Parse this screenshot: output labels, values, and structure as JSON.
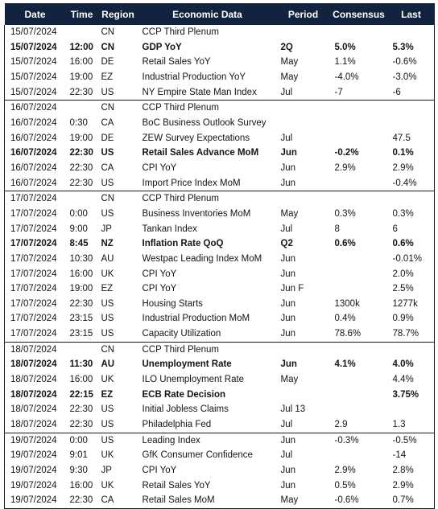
{
  "table": {
    "columns": [
      {
        "key": "date",
        "label": "Date"
      },
      {
        "key": "time",
        "label": "Time"
      },
      {
        "key": "region",
        "label": "Region"
      },
      {
        "key": "data",
        "label": "Economic Data"
      },
      {
        "key": "period",
        "label": "Period"
      },
      {
        "key": "consensus",
        "label": "Consensus"
      },
      {
        "key": "last",
        "label": "Last"
      }
    ],
    "header_background": "#12233f",
    "header_text_color": "#ffffff",
    "rows": [
      {
        "date": "15/07/2024",
        "time": "",
        "region": "CN",
        "data": "CCP Third Plenum",
        "period": "",
        "consensus": "",
        "last": "",
        "highlight": false,
        "group_start": true
      },
      {
        "date": "15/07/2024",
        "time": "12:00",
        "region": "CN",
        "data": "GDP YoY",
        "period": "2Q",
        "consensus": "5.0%",
        "last": "5.3%",
        "highlight": true,
        "group_start": false
      },
      {
        "date": "15/07/2024",
        "time": "16:00",
        "region": "DE",
        "data": "Retail Sales YoY",
        "period": "May",
        "consensus": "1.1%",
        "last": "-0.6%",
        "highlight": false,
        "group_start": false
      },
      {
        "date": "15/07/2024",
        "time": "19:00",
        "region": "EZ",
        "data": "Industrial Production YoY",
        "period": "May",
        "consensus": "-4.0%",
        "last": "-3.0%",
        "highlight": false,
        "group_start": false
      },
      {
        "date": "15/07/2024",
        "time": "22:30",
        "region": "US",
        "data": "NY Empire State Man Index",
        "period": "Jul",
        "consensus": "-7",
        "last": "-6",
        "highlight": false,
        "group_start": false
      },
      {
        "date": "16/07/2024",
        "time": "",
        "region": "CN",
        "data": "CCP Third Plenum",
        "period": "",
        "consensus": "",
        "last": "",
        "highlight": false,
        "group_start": true
      },
      {
        "date": "16/07/2024",
        "time": "0:30",
        "region": "CA",
        "data": "BoC Business Outlook Survey",
        "period": "",
        "consensus": "",
        "last": "",
        "highlight": false,
        "group_start": false
      },
      {
        "date": "16/07/2024",
        "time": "19:00",
        "region": "DE",
        "data": "ZEW Survey Expectations",
        "period": "Jul",
        "consensus": "",
        "last": "47.5",
        "highlight": false,
        "group_start": false
      },
      {
        "date": "16/07/2024",
        "time": "22:30",
        "region": "US",
        "data": "Retail Sales Advance MoM",
        "period": "Jun",
        "consensus": "-0.2%",
        "last": "0.1%",
        "highlight": true,
        "group_start": false
      },
      {
        "date": "16/07/2024",
        "time": "22:30",
        "region": "CA",
        "data": "CPI YoY",
        "period": "Jun",
        "consensus": "2.9%",
        "last": "2.9%",
        "highlight": false,
        "group_start": false
      },
      {
        "date": "16/07/2024",
        "time": "22:30",
        "region": "US",
        "data": "Import Price Index MoM",
        "period": "Jun",
        "consensus": "",
        "last": "-0.4%",
        "highlight": false,
        "group_start": false
      },
      {
        "date": "17/07/2024",
        "time": "",
        "region": "CN",
        "data": "CCP Third Plenum",
        "period": "",
        "consensus": "",
        "last": "",
        "highlight": false,
        "group_start": true
      },
      {
        "date": "17/07/2024",
        "time": "0:00",
        "region": "US",
        "data": "Business Inventories MoM",
        "period": "May",
        "consensus": "0.3%",
        "last": "0.3%",
        "highlight": false,
        "group_start": false
      },
      {
        "date": "17/07/2024",
        "time": "9:00",
        "region": "JP",
        "data": "Tankan Index",
        "period": "Jul",
        "consensus": "8",
        "last": "6",
        "highlight": false,
        "group_start": false
      },
      {
        "date": "17/07/2024",
        "time": "8:45",
        "region": "NZ",
        "data": "Inflation Rate QoQ",
        "period": "Q2",
        "consensus": "0.6%",
        "last": "0.6%",
        "highlight": true,
        "group_start": false
      },
      {
        "date": "17/07/2024",
        "time": "10:30",
        "region": "AU",
        "data": "Westpac Leading Index MoM",
        "period": "Jun",
        "consensus": "",
        "last": "-0.01%",
        "highlight": false,
        "group_start": false
      },
      {
        "date": "17/07/2024",
        "time": "16:00",
        "region": "UK",
        "data": "CPI YoY",
        "period": "Jun",
        "consensus": "",
        "last": "2.0%",
        "highlight": false,
        "group_start": false
      },
      {
        "date": "17/07/2024",
        "time": "19:00",
        "region": "EZ",
        "data": "CPI YoY",
        "period": "Jun F",
        "consensus": "",
        "last": "2.5%",
        "highlight": false,
        "group_start": false
      },
      {
        "date": "17/07/2024",
        "time": "22:30",
        "region": "US",
        "data": "Housing Starts",
        "period": "Jun",
        "consensus": "1300k",
        "last": "1277k",
        "highlight": false,
        "group_start": false
      },
      {
        "date": "17/07/2024",
        "time": "23:15",
        "region": "US",
        "data": "Industrial Production MoM",
        "period": "Jun",
        "consensus": "0.4%",
        "last": "0.9%",
        "highlight": false,
        "group_start": false
      },
      {
        "date": "17/07/2024",
        "time": "23:15",
        "region": "US",
        "data": "Capacity Utilization",
        "period": "Jun",
        "consensus": "78.6%",
        "last": "78.7%",
        "highlight": false,
        "group_start": false
      },
      {
        "date": "18/07/2024",
        "time": "",
        "region": "CN",
        "data": "CCP Third Plenum",
        "period": "",
        "consensus": "",
        "last": "",
        "highlight": false,
        "group_start": true
      },
      {
        "date": "18/07/2024",
        "time": "11:30",
        "region": "AU",
        "data": "Unemployment Rate",
        "period": "Jun",
        "consensus": "4.1%",
        "last": "4.0%",
        "highlight": true,
        "group_start": false
      },
      {
        "date": "18/07/2024",
        "time": "16:00",
        "region": "UK",
        "data": "ILO Unemployment Rate",
        "period": "May",
        "consensus": "",
        "last": "4.4%",
        "highlight": false,
        "group_start": false
      },
      {
        "date": "18/07/2024",
        "time": "22:15",
        "region": "EZ",
        "data": "ECB Rate Decision",
        "period": "",
        "consensus": "",
        "last": "3.75%",
        "highlight": true,
        "group_start": false
      },
      {
        "date": "18/07/2024",
        "time": "22:30",
        "region": "US",
        "data": "Initial Jobless Claims",
        "period": "Jul 13",
        "consensus": "",
        "last": "",
        "highlight": false,
        "group_start": false
      },
      {
        "date": "18/07/2024",
        "time": "22:30",
        "region": "US",
        "data": "Philadelphia Fed",
        "period": "Jul",
        "consensus": "2.9",
        "last": "1.3",
        "highlight": false,
        "group_start": false
      },
      {
        "date": "19/07/2024",
        "time": "0:00",
        "region": "US",
        "data": "Leading Index",
        "period": "Jun",
        "consensus": "-0.3%",
        "last": "-0.5%",
        "highlight": false,
        "group_start": true
      },
      {
        "date": "19/07/2024",
        "time": "9:01",
        "region": "UK",
        "data": "GfK Consumer Confidence",
        "period": "Jul",
        "consensus": "",
        "last": "-14",
        "highlight": false,
        "group_start": false
      },
      {
        "date": "19/07/2024",
        "time": "9:30",
        "region": "JP",
        "data": "CPI YoY",
        "period": "Jun",
        "consensus": "2.9%",
        "last": "2.8%",
        "highlight": false,
        "group_start": false
      },
      {
        "date": "19/07/2024",
        "time": "16:00",
        "region": "UK",
        "data": "Retail Sales YoY",
        "period": "Jun",
        "consensus": "0.5%",
        "last": "2.9%",
        "highlight": false,
        "group_start": false
      },
      {
        "date": "19/07/2024",
        "time": "22:30",
        "region": "CA",
        "data": "Retail Sales MoM",
        "period": "May",
        "consensus": "-0.6%",
        "last": "0.7%",
        "highlight": false,
        "group_start": false
      }
    ]
  }
}
